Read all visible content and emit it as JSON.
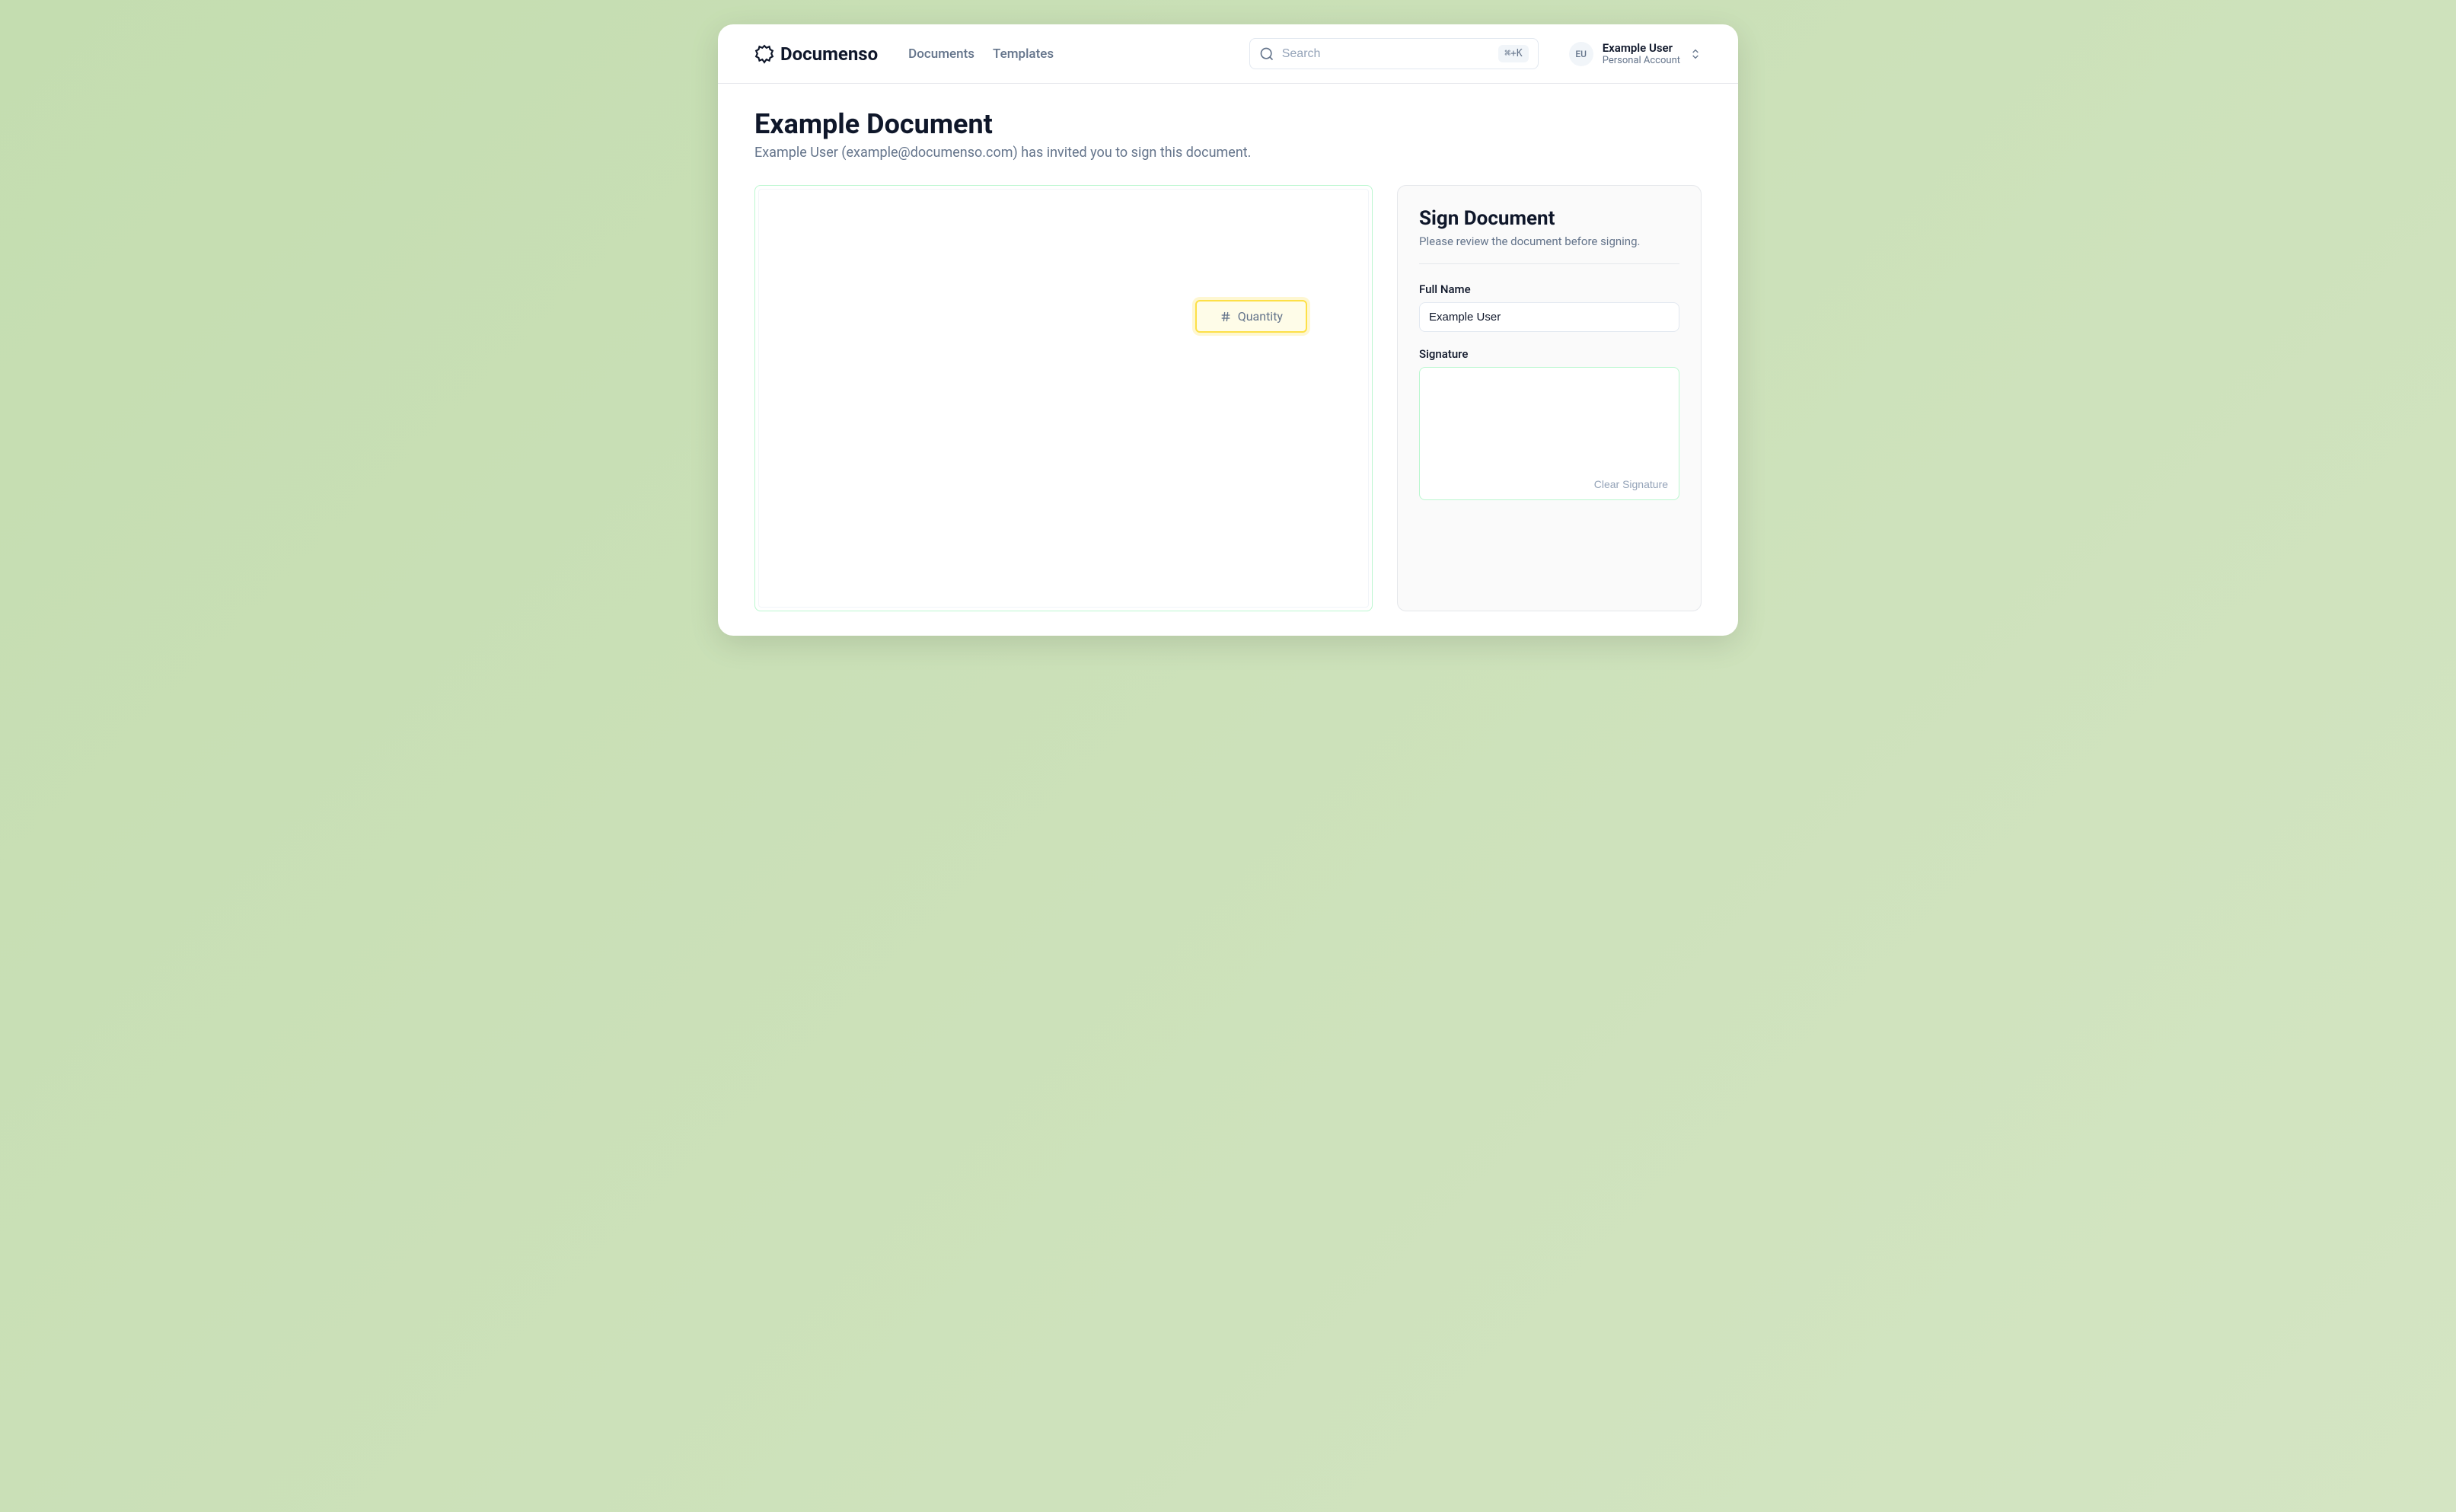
{
  "header": {
    "brand": "Documenso",
    "nav": {
      "documents": "Documents",
      "templates": "Templates"
    },
    "search": {
      "placeholder": "Search",
      "shortcut": "⌘+K"
    },
    "user": {
      "initials": "EU",
      "name": "Example User",
      "role": "Personal Account"
    }
  },
  "page": {
    "title": "Example Document",
    "subtitle": "Example User (example@documenso.com) has invited you to sign this document."
  },
  "document": {
    "field_label": "Quantity"
  },
  "sidebar": {
    "title": "Sign Document",
    "subtitle": "Please review the document before signing.",
    "fullname_label": "Full Name",
    "fullname_value": "Example User",
    "signature_label": "Signature",
    "clear_signature": "Clear Signature"
  }
}
